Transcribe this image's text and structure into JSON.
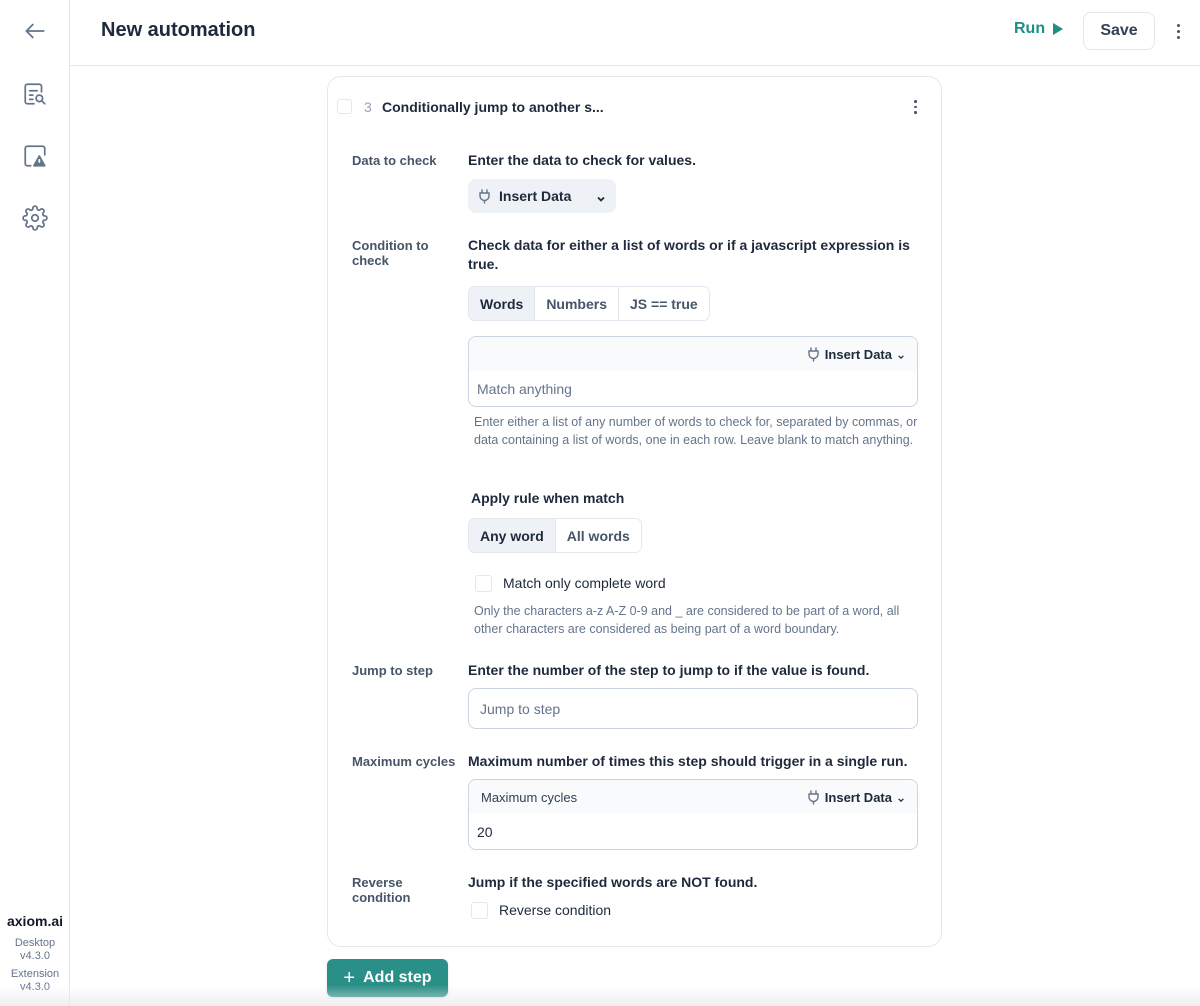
{
  "header": {
    "title": "New automation",
    "run_label": "Run",
    "save_label": "Save"
  },
  "sidebar": {
    "items": [
      {
        "icon": "back-arrow-icon"
      },
      {
        "icon": "document-search-icon"
      },
      {
        "icon": "alert-screen-icon"
      },
      {
        "icon": "gear-icon"
      }
    ],
    "brand": "axiom.ai",
    "desktop_label": "Desktop",
    "desktop_version": "v4.3.0",
    "extension_label": "Extension",
    "extension_version": "v4.3.0"
  },
  "step": {
    "number": "3",
    "title": "Conditionally jump to another s...",
    "data_to_check": {
      "label": "Data to check",
      "description": "Enter the data to check for values.",
      "insert_label": "Insert Data"
    },
    "condition": {
      "label": "Condition to check",
      "description": "Check data for either a list of words or if a javascript expression is true.",
      "tabs": [
        {
          "label": "Words",
          "active": true
        },
        {
          "label": "Numbers",
          "active": false
        },
        {
          "label": "JS == true",
          "active": false
        }
      ],
      "insert_label": "Insert Data",
      "placeholder": "Match anything",
      "help": "Enter either a list of any number of words to check for, separated by commas, or data containing a list of words, one in each row. Leave blank to match anything.",
      "apply_rule_label": "Apply rule when match",
      "apply_rule_options": [
        {
          "label": "Any word",
          "active": true
        },
        {
          "label": "All words",
          "active": false
        }
      ],
      "complete_word_label": "Match only complete word",
      "complete_word_checked": false,
      "complete_word_help": "Only the characters a-z A-Z 0-9 and _ are considered to be part of a word, all other characters are considered as being part of a word boundary."
    },
    "jump_to_step": {
      "label": "Jump to step",
      "description": "Enter the number of the step to jump to if the value is found.",
      "placeholder": "Jump to step",
      "value": ""
    },
    "max_cycles": {
      "label": "Maximum cycles",
      "description": "Maximum number of times this step should trigger in a single run.",
      "field_label": "Maximum cycles",
      "insert_label": "Insert Data",
      "value": "20"
    },
    "reverse": {
      "label": "Reverse condition",
      "description": "Jump if the specified words are NOT found.",
      "checkbox_label": "Reverse condition",
      "checked": false
    }
  },
  "add_step_label": "Add step",
  "colors": {
    "accent": "#2a9087",
    "run_text": "#1e8f86",
    "border": "#e2e8f0",
    "segment_active": "#eef2f7"
  }
}
